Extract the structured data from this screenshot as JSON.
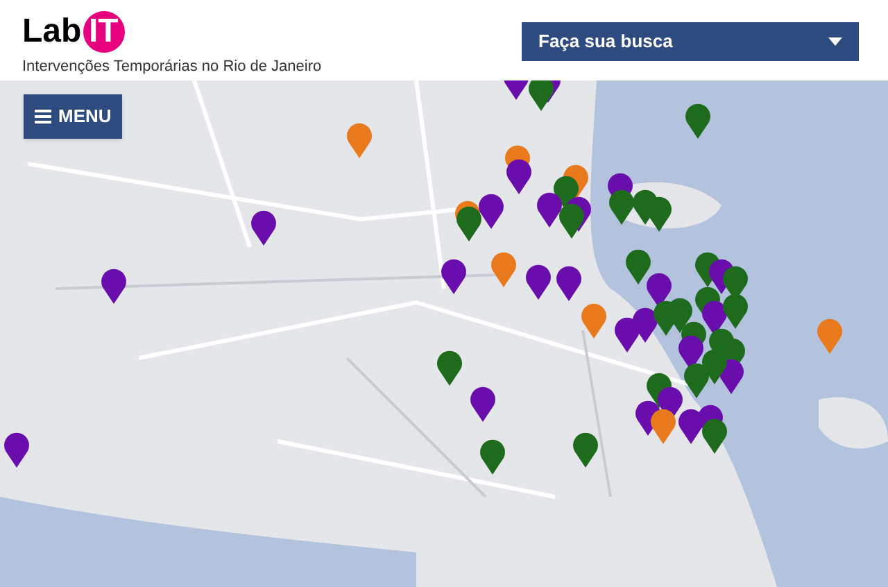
{
  "logo": {
    "text": "Lab",
    "badge": "IT"
  },
  "tagline": "Intervenções Temporárias no Rio de Janeiro",
  "search_dropdown": {
    "label": "Faça sua busca"
  },
  "menu_button": {
    "label": "MENU"
  }
}
